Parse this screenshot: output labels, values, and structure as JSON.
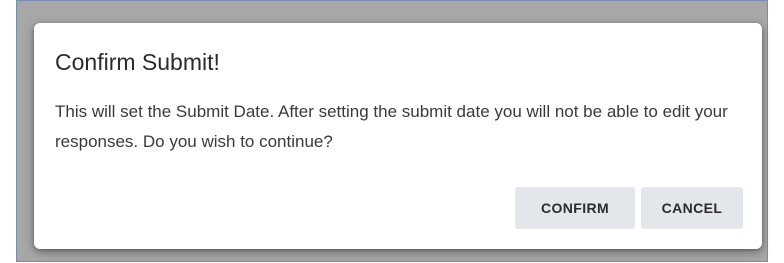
{
  "dialog": {
    "title": "Confirm Submit!",
    "message": "This will set the Submit Date. After setting the submit date you will not be able to edit your responses. Do you wish to continue?",
    "confirm_label": "CONFIRM",
    "cancel_label": "CANCEL"
  },
  "colors": {
    "overlay": "#a7a7a7",
    "dialog_bg": "#ffffff",
    "button_bg": "#e3e6ea",
    "frame_border": "#7a8cb0"
  }
}
